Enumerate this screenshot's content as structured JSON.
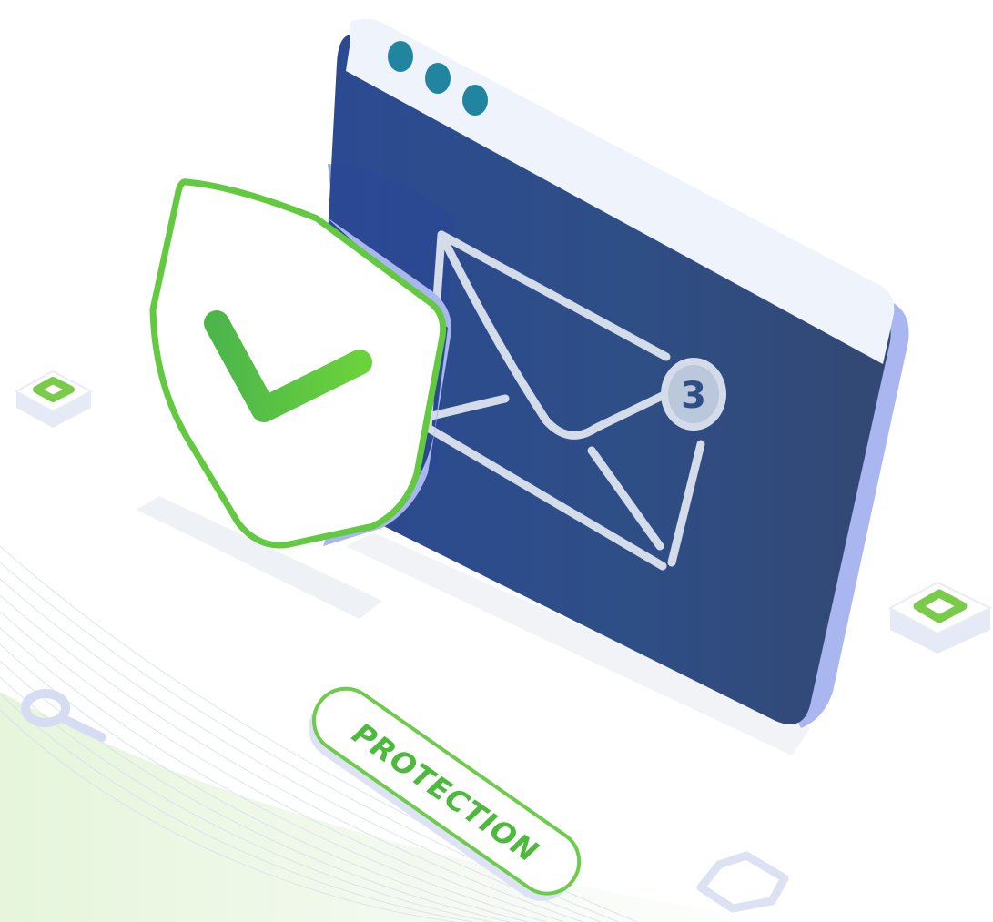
{
  "badge": {
    "label": "PROTECTION"
  },
  "envelope": {
    "notification_count": "3"
  },
  "colors": {
    "window_blue": "#2E4E86",
    "window_titlebar": "#EEF3FC",
    "window_side": "#A9B6F0",
    "window_dots": "#21859F",
    "shield_green": "#63C941",
    "check_green": "#4DB64B",
    "envelope_line": "#D4DCEA",
    "badge_text": "#4DBA3E"
  },
  "icons": [
    "shield-check-icon",
    "envelope-icon",
    "notification-badge",
    "window-dots-icon",
    "magnifier-icon",
    "shield-outline-icon",
    "floating-square-icon"
  ]
}
